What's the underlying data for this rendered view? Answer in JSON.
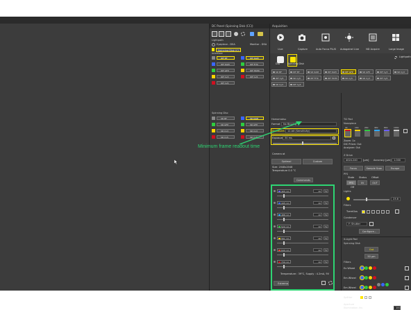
{
  "pc_panel": {
    "title": "DC Panel (Spinning Disk (CC))",
    "lightpath_label": "Lightpath",
    "eyepiece_label": "Eyepiece - DSA",
    "monitor_label": "Monitor - DSA",
    "mode_label": "Spinning Disk (C)",
    "widefield_label": "Interface",
    "widefield_left": [
      "WF BF",
      "WF DAPI",
      "WF GFP",
      "WF Cy3",
      "WF Cy5"
    ],
    "widefield_right": [
      "WF DAPI",
      "WF FITC",
      "WF TRITC",
      "WF Cy5"
    ],
    "spinning_label": "Spinning Disc",
    "spinning_left": [
      "SD BF",
      "SD GFP",
      "SD Cy3",
      "SD Cy5"
    ],
    "spinning_right": [
      "SD DAPI",
      "SD GFP",
      "SD Cy3",
      "SD Cy5"
    ]
  },
  "acq_panel": {
    "title": "Acquisition",
    "toolbar": [
      {
        "label": "Live"
      },
      {
        "label": "Capture"
      },
      {
        "label": "Auto Focus PLUS"
      },
      {
        "label": "Autogainel Live"
      },
      {
        "label": "ND Acquire"
      },
      {
        "label": "Large Image"
      }
    ],
    "lightpath_btn": "Lightpath",
    "mode_buttons": [
      "DIA",
      "Spinning Disk"
    ],
    "opt_tiles_row1": [
      "SD BF",
      "WF BF",
      "SD DAPI",
      "WF DAPI",
      "WF GFP",
      "SD GFP",
      "WF Cy3",
      "SD Cy3"
    ],
    "opt_tiles_row2": [
      "WF Cy5",
      "SD Cy5",
      "WF FITC",
      "WF TRITC",
      "SD Cy5",
      "SD Cy3",
      "WF Cy5"
    ],
    "opt_tiles_row3": [
      "SD Cy3",
      "WF Cy3"
    ],
    "camera_title": "Hamamatsu",
    "format_label": "Format",
    "format_value": "No Binning",
    "readout_label": "ReadoutM.",
    "readout_value": "12-bit (Sensitivity)",
    "exposure_label": "Exposure",
    "exposure_value": "30 ms",
    "roi_label": "Camera at",
    "roi_btn1": "Optimal",
    "roi_btn2": "Custom",
    "size_text": "Size: 2048x2048",
    "temp_text": "Temperature 0.0 °C",
    "commands_label": "Commands",
    "laser_channels": [
      {
        "name": "405 nm",
        "value": "10",
        "unit": "%",
        "color": "#6a5cff",
        "knob": 0.12
      },
      {
        "name": "445 nm",
        "value": "10",
        "unit": "%",
        "color": "#3b66ff",
        "knob": 0.12
      },
      {
        "name": "488 nm",
        "value": "10",
        "unit": "%",
        "color": "#2ea8ff",
        "knob": 0.12
      },
      {
        "name": "520 nm",
        "value": "10",
        "unit": "%",
        "color": "#2ecc40",
        "knob": 0.12
      },
      {
        "name": "561 nm",
        "value": "10",
        "unit": "%",
        "color": "#ffd400",
        "knob": 0.12
      },
      {
        "name": "640 nm",
        "value": "10",
        "unit": "%",
        "color": "#ff4030",
        "knob": 0.12
      },
      {
        "name": "730 nm",
        "value": "10",
        "unit": "%",
        "color": "#d01020",
        "knob": 0.12
      }
    ],
    "laser_status": "Temperature : 39°C, Supply : 4.2mA, 9V",
    "laser_btn": "Extrema",
    "annotation": "Minimum frame readout time",
    "scope_title": "Ti2 Pad",
    "nosepiece_label": "Nosepiece",
    "objectives": [
      "4x",
      "10x",
      "20x",
      "40x",
      "60x",
      "100x"
    ],
    "zoom_text": "Zoom: 1x",
    "dic_text": "DIC Prism: Out",
    "analyzer_text": "Analyzer: Out",
    "zdrive_label": "Z Drive",
    "z_value": "4024.240",
    "z_unit": "[µm]",
    "accuracy_label": "Accuracy [µm]",
    "accuracy_value": "1.000",
    "focus_btns": [
      "Focus",
      "Sample Scan",
      "Escape"
    ],
    "pfs_label": "PFS",
    "pfs_state_labels": [
      "State",
      "Status",
      "Offset"
    ],
    "pfs_btns": [
      "PFS",
      "IN",
      "OUT"
    ],
    "off_text": "Off",
    "lights_label": "Lights",
    "lights_value": "23.8",
    "filters_label": "Filters",
    "turret_label": "Turret1ss",
    "condenser_label": "Condenser",
    "condenser_value": "F: Shutter",
    "configure_btn": "Configure...",
    "xlight_title": "X-Light Pad",
    "spin_label": "Spinning Disk",
    "spin_out": "Out",
    "spin_val": "50 µm",
    "filters2_label": "Filters",
    "wheels": [
      "Ex Wheel",
      "Em Wheel",
      "Em Wheel"
    ],
    "splitter_label": "Splitter",
    "aperture_label": "Aperture",
    "illum_label": "Illumination Iris",
    "illum_value": "100"
  }
}
